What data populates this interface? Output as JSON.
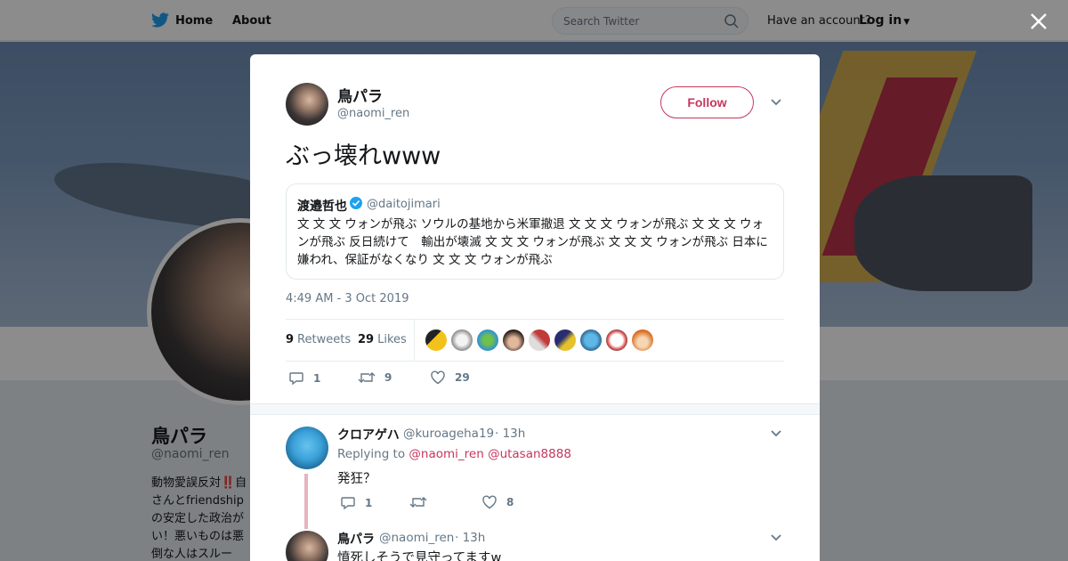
{
  "topbar": {
    "home_label": "Home",
    "about_label": "About",
    "search_placeholder": "Search Twitter",
    "have_account": "Have an account?",
    "login_label": "Log in"
  },
  "profile_bg": {
    "name": "鳥パラ",
    "handle": "@naomi_ren",
    "bio": "動物愛誤反対‼️自\nさんとfriendship\nの安定した政治が\nい！悪いものは悪\n倒な人はスルー"
  },
  "tweet": {
    "author_name": "鳥パラ",
    "author_handle": "@naomi_ren",
    "follow_label": "Follow",
    "text": "ぶっ壊れwww",
    "quote": {
      "name": "渡邉哲也",
      "handle": "@daitojimari",
      "text": "文 文 文 ウォンが飛ぶ ソウルの基地から米軍撤退 文 文 文 ウォンが飛ぶ 文 文 文 ウォンが飛ぶ 反日続けて　輸出が壊滅 文 文 文 ウォンが飛ぶ 文 文 文 ウォンが飛ぶ 日本に嫌われ、保証がなくなり 文 文 文 ウォンが飛ぶ"
    },
    "timestamp": "4:49 AM - 3 Oct 2019",
    "retweets_count": "9",
    "retweets_label": "Retweets",
    "likes_count": "29",
    "likes_label": "Likes",
    "actions": {
      "replies": "1",
      "retweets": "9",
      "likes": "29"
    }
  },
  "replies": [
    {
      "name": "クロアゲハ",
      "handle": "@kuroageha19",
      "time": "· 13h",
      "replying_prefix": "Replying to",
      "mention1": "@naomi_ren",
      "mention2": "@utasan8888",
      "text": "発狂？",
      "reply_count": "1",
      "retweet_count": "",
      "like_count": "8"
    },
    {
      "name": "鳥パラ",
      "handle": "@naomi_ren",
      "time": "· 13h",
      "text": "憤死しそうで見守ってますw"
    }
  ],
  "colors": {
    "accent": "#c6375d",
    "twitter_blue": "#1da1f2",
    "muted": "#657786"
  }
}
